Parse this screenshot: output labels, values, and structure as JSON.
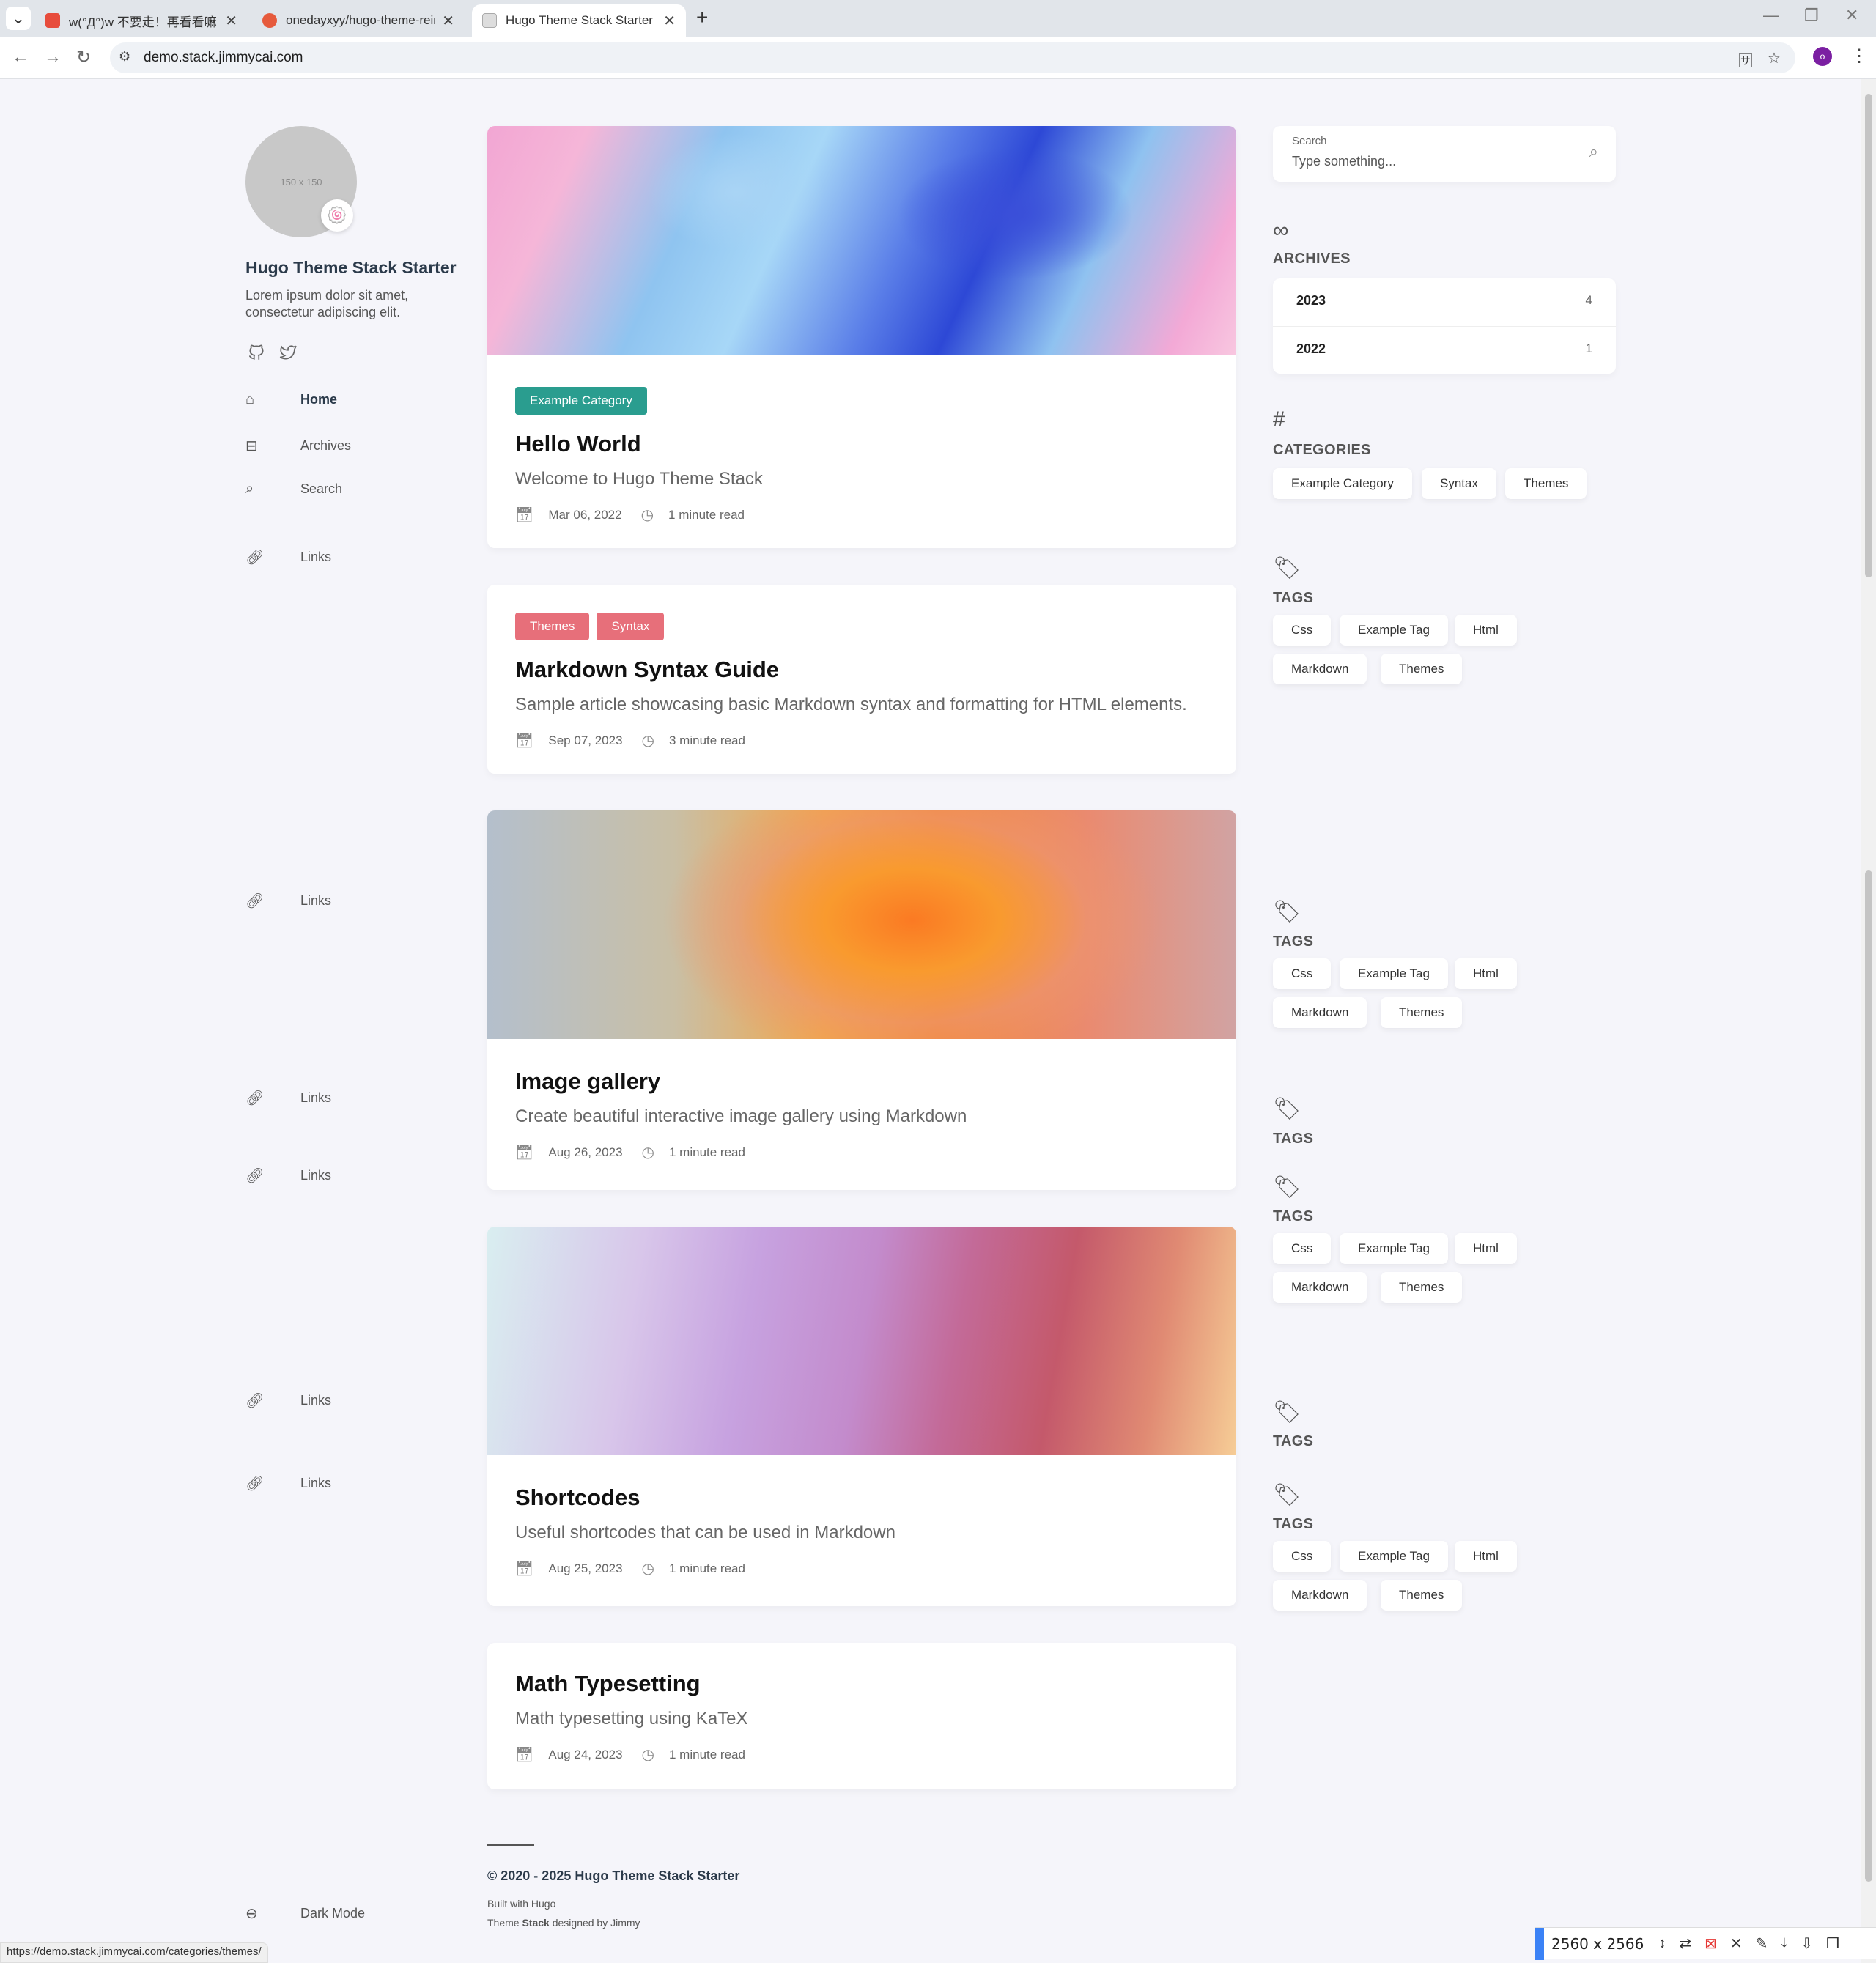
{
  "browser": {
    "tabs": [
      {
        "title": "w(°Д°)w 不要走！再看看嘛！",
        "active": false
      },
      {
        "title": "onedayxyy/hugo-theme-reim",
        "active": false
      },
      {
        "title": "Hugo Theme Stack Starter",
        "active": true
      }
    ],
    "url": "demo.stack.jimmycai.com",
    "profile_initial": "o"
  },
  "sidebar": {
    "avatar_placeholder": "150 x 150",
    "avatar_emoji": "🍥",
    "title": "Hugo Theme Stack Starter",
    "description": "Lorem ipsum dolor sit amet, consectetur adipiscing elit.",
    "nav": {
      "home": "Home",
      "archives": "Archives",
      "search": "Search",
      "links": "Links",
      "dark_mode": "Dark Mode"
    }
  },
  "articles": [
    {
      "categories": [
        "Example Category"
      ],
      "title": "Hello World",
      "subtitle": "Welcome to Hugo Theme Stack",
      "date": "Mar 06, 2022",
      "read_time": "1 minute read"
    },
    {
      "categories": [
        "Themes",
        "Syntax"
      ],
      "title": "Markdown Syntax Guide",
      "subtitle": "Sample article showcasing basic Markdown syntax and formatting for HTML elements.",
      "date": "Sep 07, 2023",
      "read_time": "3 minute read"
    },
    {
      "categories": [],
      "title": "Image gallery",
      "subtitle": "Create beautiful interactive image gallery using Markdown",
      "date": "Aug 26, 2023",
      "read_time": "1 minute read"
    },
    {
      "categories": [],
      "title": "Shortcodes",
      "subtitle": "Useful shortcodes that can be used in Markdown",
      "date": "Aug 25, 2023",
      "read_time": "1 minute read"
    },
    {
      "categories": [],
      "title": "Math Typesetting",
      "subtitle": "Math typesetting using KaTeX",
      "date": "Aug 24, 2023",
      "read_time": "1 minute read"
    }
  ],
  "widgets": {
    "search": {
      "label": "Search",
      "placeholder": "Type something..."
    },
    "archives": {
      "title": "ARCHIVES",
      "items": [
        {
          "year": "2023",
          "count": "4"
        },
        {
          "year": "2022",
          "count": "1"
        }
      ]
    },
    "categories": {
      "title": "CATEGORIES",
      "items": [
        "Example Category",
        "Syntax",
        "Themes"
      ]
    },
    "tags": {
      "title": "TAGS",
      "items": [
        "Css",
        "Example Tag",
        "Html",
        "Markdown",
        "Themes"
      ]
    }
  },
  "footer": {
    "copyright": "© 2020 - 2025 Hugo Theme Stack Starter",
    "built_with": "Built with Hugo",
    "theme_prefix": "Theme",
    "theme_name": "Stack",
    "theme_suffix": "designed by Jimmy"
  },
  "status_url": "https://demo.stack.jimmycai.com/categories/themes/",
  "ext": {
    "size": "2560 x 2566"
  },
  "colors": {
    "category_green": "#2a9d8f",
    "category_red": "#e76f7a",
    "page_bg": "#f5f5fa",
    "profile": "#7b1fa2"
  }
}
